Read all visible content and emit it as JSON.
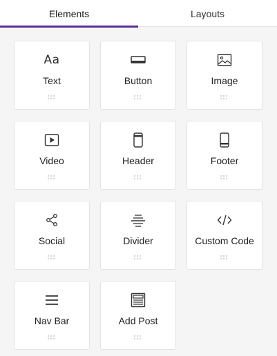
{
  "tabs": [
    {
      "label": "Elements",
      "active": true
    },
    {
      "label": "Layouts",
      "active": false
    }
  ],
  "accent_color": "#5b2c98",
  "elements": [
    {
      "label": "Text",
      "icon": "text-aa-icon",
      "glyph": "Aa"
    },
    {
      "label": "Button",
      "icon": "button-icon"
    },
    {
      "label": "Image",
      "icon": "image-icon"
    },
    {
      "label": "Video",
      "icon": "video-play-icon"
    },
    {
      "label": "Header",
      "icon": "header-phone-icon"
    },
    {
      "label": "Footer",
      "icon": "footer-phone-icon"
    },
    {
      "label": "Social",
      "icon": "share-icon"
    },
    {
      "label": "Divider",
      "icon": "divider-icon"
    },
    {
      "label": "Custom Code",
      "icon": "code-icon"
    },
    {
      "label": "Nav Bar",
      "icon": "hamburger-menu-icon"
    },
    {
      "label": "Add Post",
      "icon": "post-layout-icon"
    }
  ]
}
